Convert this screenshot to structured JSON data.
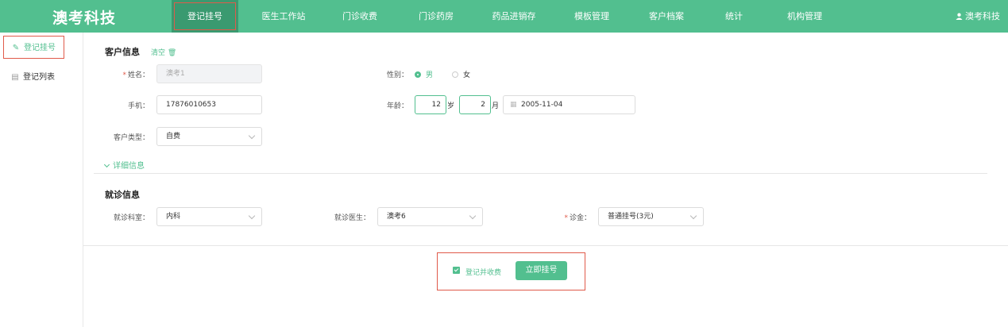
{
  "app": {
    "logo": "澳考科技",
    "user": "澳考科技"
  },
  "nav": [
    {
      "label": "登记挂号",
      "active": true
    },
    {
      "label": "医生工作站"
    },
    {
      "label": "门诊收费"
    },
    {
      "label": "门诊药房"
    },
    {
      "label": "药品进销存"
    },
    {
      "label": "模板管理"
    },
    {
      "label": "客户档案"
    },
    {
      "label": "统计"
    },
    {
      "label": "机构管理"
    }
  ],
  "sidebar": {
    "items": [
      {
        "label": "登记挂号"
      },
      {
        "label": "登记列表"
      }
    ]
  },
  "customer": {
    "title": "客户信息",
    "clear": "清空",
    "name": {
      "label": "姓名：",
      "value": "澳考1"
    },
    "gender": {
      "label": "性别：",
      "options": [
        "男",
        "女"
      ],
      "selected": "男"
    },
    "phone": {
      "label": "手机：",
      "value": "17876010653"
    },
    "age": {
      "label": "年龄：",
      "years": "12",
      "years_unit": "岁",
      "months": "2",
      "months_unit": "月",
      "birthdate": "2005-11-04"
    },
    "type": {
      "label": "客户类型：",
      "value": "自费"
    },
    "details_toggle": "详细信息"
  },
  "visit": {
    "title": "就诊信息",
    "department": {
      "label": "就诊科室：",
      "value": "内科"
    },
    "doctor": {
      "label": "就诊医生：",
      "value": "澳考6"
    },
    "fee": {
      "label": "诊金：",
      "value": "普通挂号(3元)"
    }
  },
  "footer": {
    "charge_label": "登记并收费",
    "charge_checked": true,
    "submit": "立即挂号"
  },
  "colors": {
    "brand": "#52bf8f",
    "highlight": "#e05a4a"
  }
}
